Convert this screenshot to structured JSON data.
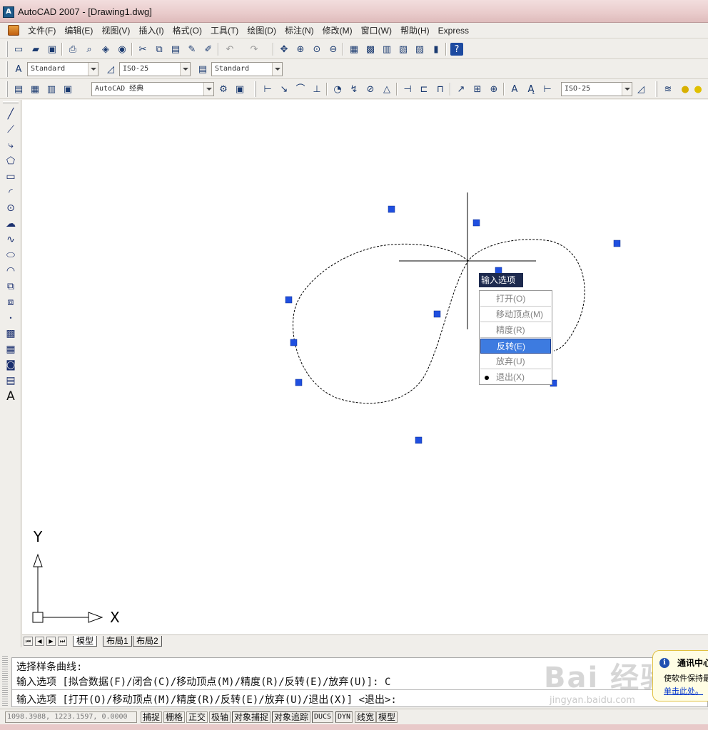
{
  "window": {
    "title": "AutoCAD 2007 - [Drawing1.dwg]",
    "icon": "autocad-app-icon"
  },
  "menu": {
    "items": [
      "文件(F)",
      "编辑(E)",
      "视图(V)",
      "插入(I)",
      "格式(O)",
      "工具(T)",
      "绘图(D)",
      "标注(N)",
      "修改(M)",
      "窗口(W)",
      "帮助(H)",
      "Express"
    ]
  },
  "styles_toolbar": {
    "text_style": "Standard",
    "dim_style": "ISO-25",
    "table_style": "Standard"
  },
  "workspace_toolbar": {
    "workspace": "AutoCAD 经典",
    "dim_style": "ISO-25"
  },
  "drawing": {
    "context_menu_title": "输入选项",
    "context_menu": [
      {
        "label": "打开(O)",
        "enabled": false
      },
      {
        "label": "移动顶点(M)",
        "enabled": false
      },
      {
        "label": "精度(R)",
        "enabled": false
      },
      {
        "label": "反转(E)",
        "enabled": true,
        "highlighted": true
      },
      {
        "label": "放弃(U)",
        "enabled": false
      },
      {
        "label": "退出(X)",
        "enabled": false,
        "default": true
      }
    ],
    "ucs": {
      "x_label": "X",
      "y_label": "Y"
    }
  },
  "layout_tabs": {
    "tabs": [
      "模型",
      "布局1",
      "布局2"
    ],
    "active": "模型"
  },
  "command": {
    "line1": "选择样条曲线:",
    "line2": "输入选项 [拟合数据(F)/闭合(C)/移动顶点(M)/精度(R)/反转(E)/放弃(U)]: C",
    "line3": "输入选项 [打开(O)/移动顶点(M)/精度(R)/反转(E)/放弃(U)/退出(X)] <退出>:"
  },
  "status": {
    "coordinates": "1098.3988, 1223.1597, 0.0000",
    "toggles": [
      "捕捉",
      "栅格",
      "正交",
      "极轴",
      "对象捕捉",
      "对象追踪",
      "DUCS",
      "DYN",
      "线宽",
      "模型"
    ]
  },
  "notification": {
    "title": "通讯中心",
    "body": "使软件保持最",
    "link": "单击此处。"
  },
  "watermark": {
    "main": "Bai 经验",
    "sub": "jingyan.baidu.com"
  },
  "colors": {
    "grip": "#1f4fe0",
    "menu_highlight": "#3d7be0",
    "tooltip_bg": "#1d2a4e"
  }
}
